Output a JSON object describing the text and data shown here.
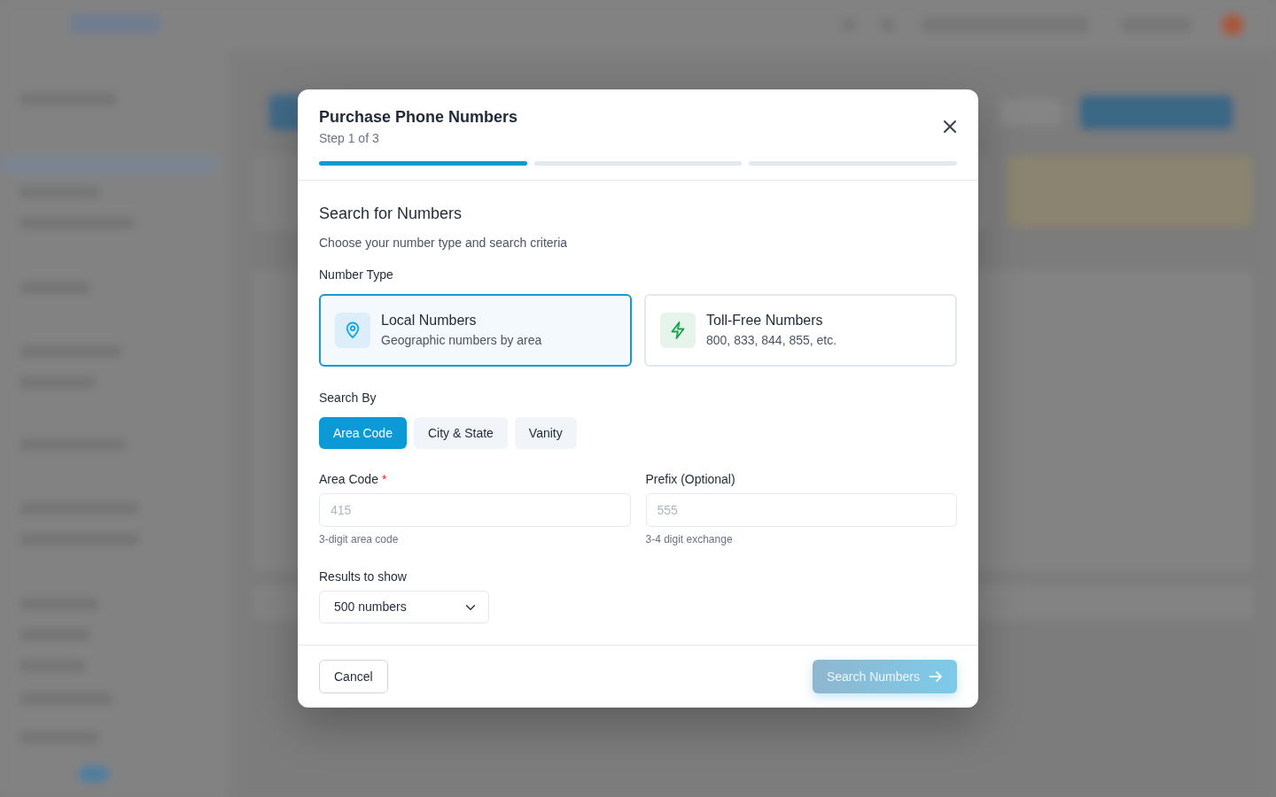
{
  "dialog": {
    "title": "Purchase Phone Numbers",
    "subtitle": "Step 1 of 3",
    "steps": [
      {
        "complete": true
      },
      {
        "complete": false
      },
      {
        "complete": false
      }
    ]
  },
  "section": {
    "title": "Search for Numbers",
    "description": "Choose your number type and search criteria"
  },
  "number_type": {
    "label": "Number Type",
    "options": [
      {
        "kind": "local",
        "title": "Local Numbers",
        "description": "Geographic numbers by area",
        "selected": true
      },
      {
        "kind": "tollfree",
        "title": "Toll-Free Numbers",
        "description": "800, 833, 844, 855, etc.",
        "selected": false
      }
    ]
  },
  "search_by": {
    "label": "Search By",
    "options": [
      {
        "label": "Area Code",
        "selected": true
      },
      {
        "label": "City & State",
        "selected": false
      },
      {
        "label": "Vanity",
        "selected": false
      }
    ]
  },
  "fields": [
    {
      "label": "Area Code",
      "required_mark": "*",
      "placeholder": "415",
      "hint": "3-digit area code"
    },
    {
      "label": "Prefix (Optional)",
      "placeholder": "555",
      "hint": "3-4 digit exchange"
    }
  ],
  "results": {
    "label": "Results to show",
    "value": "500 numbers"
  },
  "footer": {
    "cancel": "Cancel",
    "submit": {
      "label": "Search Numbers",
      "disabled": true
    }
  }
}
